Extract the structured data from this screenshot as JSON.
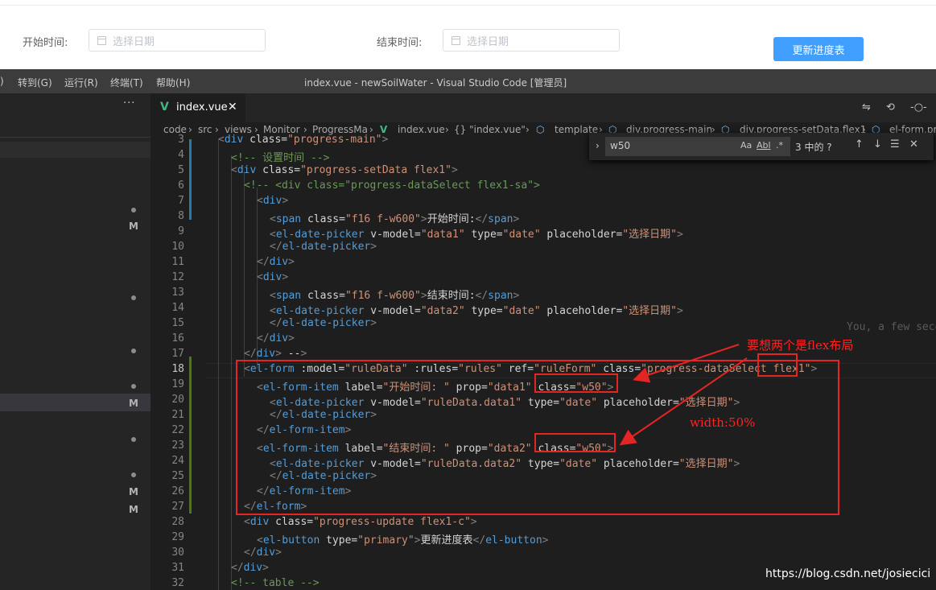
{
  "web_form": {
    "start_label": "开始时间:",
    "start_placeholder": "选择日期",
    "end_label": "结束时间:",
    "end_placeholder": "选择日期",
    "update_button": "更新进度表"
  },
  "window": {
    "menu": [
      ")",
      "转到(G)",
      "运行(R)",
      "终端(T)",
      "帮助(H)"
    ],
    "title": "index.vue - newSoilWater - Visual Studio Code [管理员]"
  },
  "sidebar": {
    "more": "···",
    "git_badge": "M"
  },
  "tab": {
    "icon": "vue-file-icon",
    "label": "index.vue",
    "close": "✕"
  },
  "tab_actions": [
    "⇋",
    "⟲",
    "-○-"
  ],
  "breadcrumb": [
    "code",
    "src",
    "views",
    "Monitor",
    "ProgressMa",
    "index.vue",
    "{} \"index.vue\"",
    "template",
    "div.progress-main",
    "div.progress-setData.flex1",
    "el-form.pr"
  ],
  "find": {
    "query": "w50",
    "case": "Aa",
    "word": "Abl",
    "regex": ".*",
    "result": "3 中的 ?",
    "prev": "↑",
    "next": "↓",
    "selection": "☰",
    "close": "✕"
  },
  "line_numbers": [
    "3",
    "4",
    "5",
    "6",
    "7",
    "8",
    "9",
    "10",
    "11",
    "12",
    "13",
    "14",
    "15",
    "16",
    "17",
    "18",
    "19",
    "20",
    "21",
    "22",
    "23",
    "24",
    "25",
    "26",
    "27",
    "28",
    "29",
    "30",
    "31",
    "32"
  ],
  "code_lines": [
    "<div class=\"progress-main\">",
    "<!-- 设置时间 -->",
    "<div class=\"progress-setData flex1\">",
    "<!-- <div class=\"progress-dataSelect flex1-sa\">",
    "<div>",
    "<span class=\"f16 f-w600\">开始时间:</span>",
    "<el-date-picker v-model=\"data1\" type=\"date\" placeholder=\"选择日期\">",
    "</el-date-picker>",
    "</div>",
    "<div>",
    "<span class=\"f16 f-w600\">结束时间:</span>",
    "<el-date-picker v-model=\"data2\" type=\"date\" placeholder=\"选择日期\">",
    "</el-date-picker>",
    "</div>",
    "</div> -->",
    "<el-form :model=\"ruleData\" :rules=\"rules\" ref=\"ruleForm\" class=\"progress-dataSelect flex1\">",
    "<el-form-item label=\"开始时间: \" prop=\"data1\" class=\"w50\">",
    "<el-date-picker v-model=\"ruleData.data1\" type=\"date\" placeholder=\"选择日期\">",
    "</el-date-picker>",
    "</el-form-item>",
    "<el-form-item label=\"结束时间: \" prop=\"data2\" class=\"w50\">",
    "<el-date-picker v-model=\"ruleData.data2\" type=\"date\" placeholder=\"选择日期\">",
    "</el-date-picker>",
    "</el-form-item>",
    "</el-form>",
    "<div class=\"progress-update flex1-c\">",
    "<el-button type=\"primary\">更新进度表</el-button>",
    "</div>",
    "</div>",
    "<!-- table -->"
  ],
  "blame": "You, a few seconds ago",
  "annotations": {
    "flex_note": "要想两个是flex布局",
    "width_note": "width:50%"
  },
  "watermark": "https://blog.csdn.net/josiecici",
  "colors": {
    "tag": "#569cd6",
    "attr": "#9cdcfe",
    "string": "#ce9178",
    "comment": "#6a9955",
    "annotation": "#e52424",
    "button": "#409eff"
  }
}
